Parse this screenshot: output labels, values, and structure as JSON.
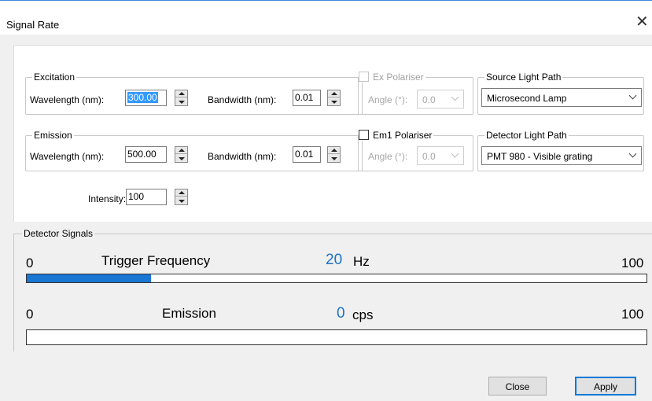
{
  "window": {
    "title": "Signal Rate",
    "close_glyph": "✕"
  },
  "excitation": {
    "legend": "Excitation",
    "wavelength_label": "Wavelength (nm):",
    "wavelength_value": "300.00",
    "bandwidth_label": "Bandwidth (nm):",
    "bandwidth_value": "0.01"
  },
  "ex_polariser": {
    "legend": "Ex Polariser",
    "angle_label": "Angle (°):",
    "angle_value": "0.0",
    "checked": false,
    "enabled": false
  },
  "source_light_path": {
    "legend": "Source Light Path",
    "selected": "Microsecond Lamp"
  },
  "emission": {
    "legend": "Emission",
    "wavelength_label": "Wavelength (nm):",
    "wavelength_value": "500.00",
    "bandwidth_label": "Bandwidth (nm):",
    "bandwidth_value": "0.01"
  },
  "em1_polariser": {
    "legend": "Em1 Polariser",
    "angle_label": "Angle (°):",
    "angle_value": "0.0",
    "checked": false,
    "angle_enabled": false
  },
  "detector_light_path": {
    "legend": "Detector Light Path",
    "selected": "PMT 980 - Visible grating"
  },
  "intensity": {
    "label": "Intensity:",
    "value": "100"
  },
  "detector_signals": {
    "legend": "Detector Signals",
    "trigger": {
      "min": "0",
      "max": "100",
      "name": "Trigger Frequency",
      "value": "20",
      "unit": "Hz",
      "fraction": 0.2
    },
    "emission": {
      "min": "0",
      "max": "100",
      "name": "Emission",
      "value": "0",
      "unit": "cps",
      "fraction": 0.0
    }
  },
  "buttons": {
    "close": "Close",
    "apply": "Apply"
  },
  "colors": {
    "accent": "#1976d2",
    "value_text": "#1a73c8",
    "title_border": "#3c8ad8"
  }
}
